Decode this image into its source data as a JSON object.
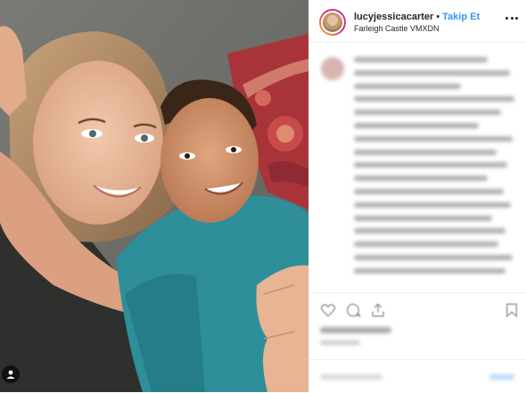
{
  "post": {
    "header": {
      "username": "lucyjessicacarter",
      "separator": "•",
      "follow_label": "Takip Et",
      "location": "Farleigh Castle VMXDN"
    },
    "caption": {
      "blurred": true,
      "line_count": 17
    },
    "icons": {
      "more": "more-options-icon",
      "like": "heart-icon",
      "comment": "comment-icon",
      "share": "share-icon",
      "save": "bookmark-icon",
      "user_tag": "user-tag-icon"
    },
    "colors": {
      "follow": "#3897f0",
      "text": "#262626",
      "border": "#efefef"
    }
  }
}
